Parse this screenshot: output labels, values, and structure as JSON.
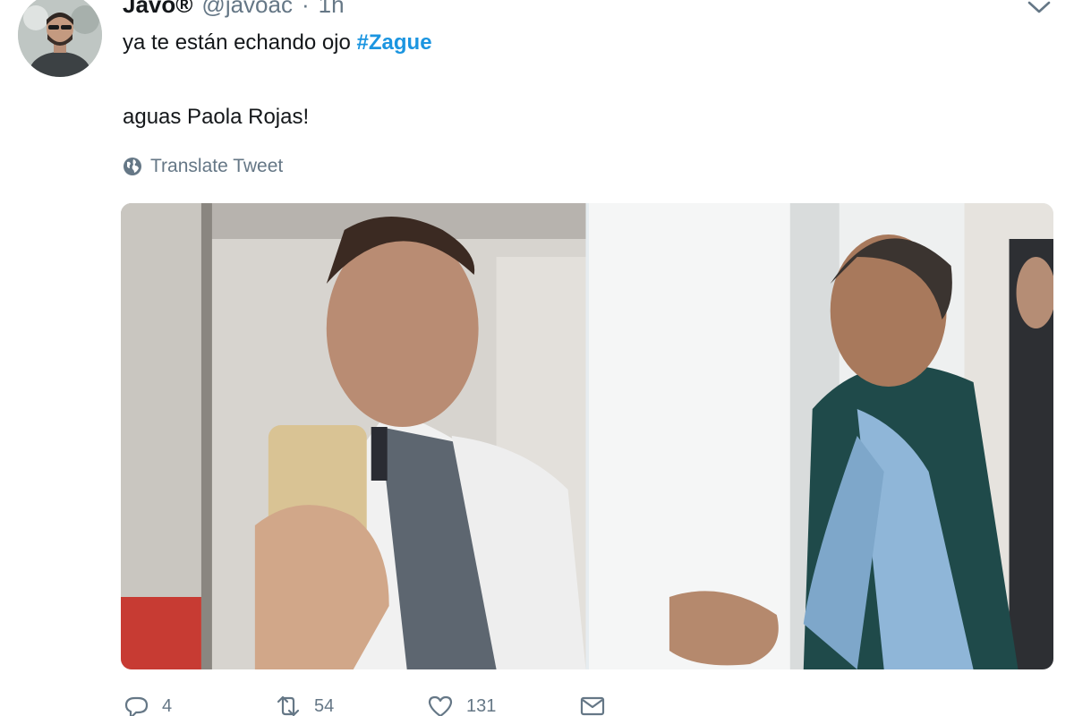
{
  "tweet": {
    "author": {
      "name": "Javo®",
      "handle": "@javoac",
      "separator": "·",
      "time": "1h"
    },
    "text_line1": "ya te están echando ojo ",
    "hashtag": "#Zague",
    "text_line2": "aguas Paola Rojas!",
    "translate_label": "Translate Tweet",
    "actions": {
      "reply_count": "4",
      "retweet_count": "54",
      "like_count": "131"
    }
  },
  "colors": {
    "link": "#1b95e0",
    "secondary_text": "#657786",
    "primary_text": "#14171a"
  },
  "icons": [
    "chevron-down-icon",
    "globe-icon",
    "reply-icon",
    "retweet-icon",
    "heart-icon",
    "envelope-icon"
  ]
}
